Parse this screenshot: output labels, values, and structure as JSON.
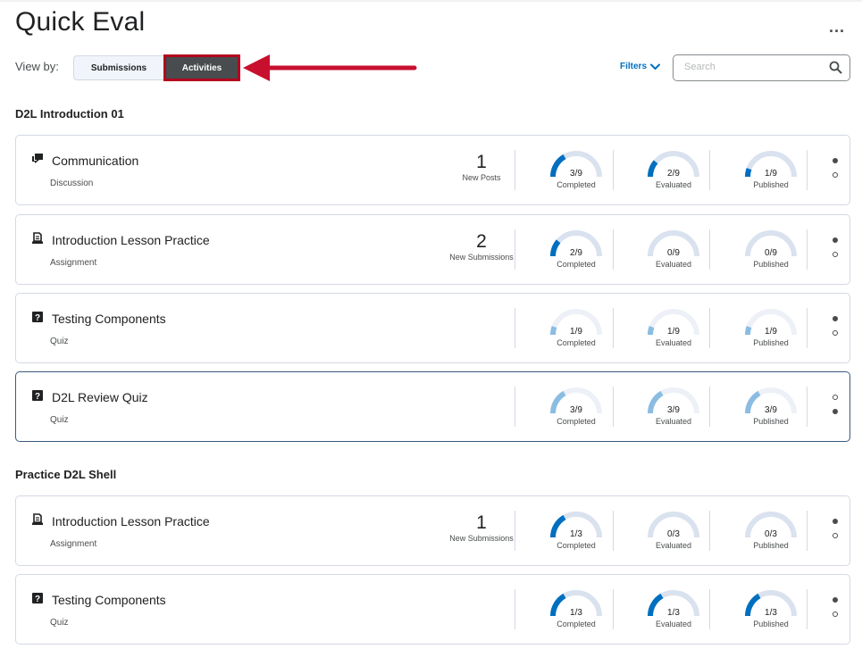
{
  "page": {
    "title": "Quick Eval",
    "more_label": "..."
  },
  "view_by": {
    "label": "View by:",
    "submissions": "Submissions",
    "activities": "Activities"
  },
  "filters": {
    "label": "Filters"
  },
  "search": {
    "placeholder": "Search"
  },
  "colors": {
    "accent": "#006fbf",
    "gauge_track": "#d9e2ee",
    "highlight_border": "#b3051d"
  },
  "groups": [
    {
      "name": "D2L Introduction 01",
      "activities": [
        {
          "name": "Communication",
          "type": "Discussion",
          "icon": "discussion-icon",
          "count": "1",
          "count_label": "New Posts",
          "completed": {
            "value": "3/9",
            "label": "Completed",
            "fraction": 0.333
          },
          "evaluated": {
            "value": "2/9",
            "label": "Evaluated",
            "fraction": 0.222
          },
          "published": {
            "value": "1/9",
            "label": "Published",
            "fraction": 0.111
          }
        },
        {
          "name": "Introduction Lesson Practice",
          "type": "Assignment",
          "icon": "assignment-icon",
          "count": "2",
          "count_label": "New Submissions",
          "completed": {
            "value": "2/9",
            "label": "Completed",
            "fraction": 0.222
          },
          "evaluated": {
            "value": "0/9",
            "label": "Evaluated",
            "fraction": 0
          },
          "published": {
            "value": "0/9",
            "label": "Published",
            "fraction": 0
          }
        },
        {
          "name": "Testing Components",
          "type": "Quiz",
          "icon": "quiz-icon",
          "count": "",
          "count_label": "",
          "completed": {
            "value": "1/9",
            "label": "Completed",
            "fraction": 0.111
          },
          "evaluated": {
            "value": "1/9",
            "label": "Evaluated",
            "fraction": 0.111
          },
          "published": {
            "value": "1/9",
            "label": "Published",
            "fraction": 0.111
          }
        },
        {
          "name": "D2L Review Quiz",
          "type": "Quiz",
          "icon": "quiz-icon",
          "count": "",
          "count_label": "",
          "completed": {
            "value": "3/9",
            "label": "Completed",
            "fraction": 0.333
          },
          "evaluated": {
            "value": "3/9",
            "label": "Evaluated",
            "fraction": 0.333
          },
          "published": {
            "value": "3/9",
            "label": "Published",
            "fraction": 0.333
          }
        }
      ]
    },
    {
      "name": "Practice D2L Shell",
      "activities": [
        {
          "name": "Introduction Lesson Practice",
          "type": "Assignment",
          "icon": "assignment-icon",
          "count": "1",
          "count_label": "New Submissions",
          "completed": {
            "value": "1/3",
            "label": "Completed",
            "fraction": 0.333
          },
          "evaluated": {
            "value": "0/3",
            "label": "Evaluated",
            "fraction": 0
          },
          "published": {
            "value": "0/3",
            "label": "Published",
            "fraction": 0
          }
        },
        {
          "name": "Testing Components",
          "type": "Quiz",
          "icon": "quiz-icon",
          "count": "",
          "count_label": "",
          "completed": {
            "value": "1/3",
            "label": "Completed",
            "fraction": 0.333
          },
          "evaluated": {
            "value": "1/3",
            "label": "Evaluated",
            "fraction": 0.333
          },
          "published": {
            "value": "1/3",
            "label": "Published",
            "fraction": 0.333
          }
        }
      ]
    }
  ]
}
